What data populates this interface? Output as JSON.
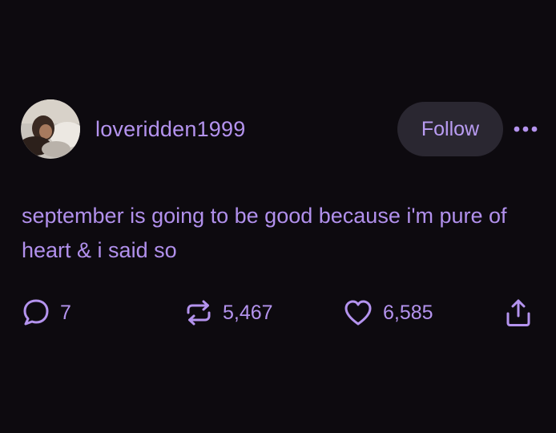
{
  "post": {
    "username": "loveridden1999",
    "follow_label": "Follow",
    "text": "september is going to be good because i'm pure of heart & i said so",
    "actions": {
      "replies": "7",
      "reposts": "5,467",
      "likes": "6,585"
    }
  },
  "colors": {
    "background": "#0d0a0f",
    "accent": "#b493ee",
    "button_bg": "#2a2731"
  },
  "icons": {
    "more": "more-dots-icon",
    "reply": "speech-bubble-icon",
    "repost": "repost-arrows-icon",
    "like": "heart-icon",
    "share": "share-upload-icon"
  }
}
